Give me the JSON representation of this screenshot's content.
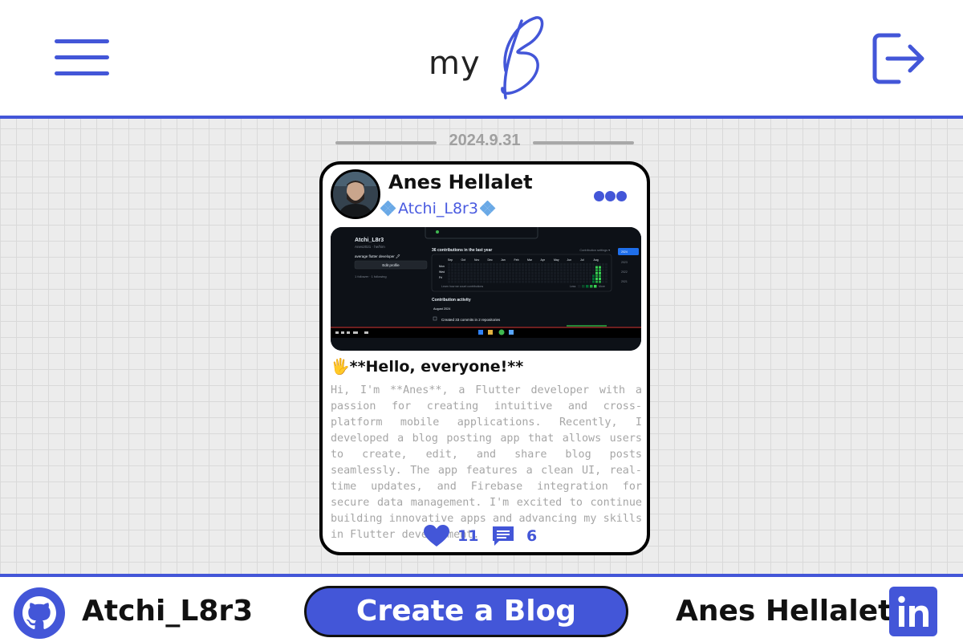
{
  "header": {
    "logo_text": "my",
    "logo_letter": "B",
    "accent_color": "#4356d8"
  },
  "feed": {
    "date": "2024.9.31",
    "post": {
      "author_name": "Anes Hellalet",
      "author_handle": "Atchi_L8r3",
      "title": "🖐**Hello, everyone!**",
      "body": "Hi, I'm **Anes**, a Flutter developer with a passion for creating intuitive and cross-platform mobile applications. Recently, I developed a blog posting app that allows users to create, edit, and share blog posts seamlessly. The app features a clean UI, real-time updates, and Firebase integration for secure data management. I'm excited to continue building innovative apps and advancing my skills in Flutter development.",
      "likes": "11",
      "comments": "6",
      "image": {
        "profile_name": "Atchi_L8r3",
        "profile_sub": "Anes2021 · he/him",
        "profile_bio": "average flutter developer 🖋",
        "edit_profile": "Edit profile",
        "followers": "1 follower · 1 following",
        "contrib_title": "36 contributions in the last year",
        "contrib_settings": "Contribution settings ▾",
        "months": [
          "Sep",
          "Oct",
          "Nov",
          "Dec",
          "Jan",
          "Feb",
          "Mar",
          "Apr",
          "May",
          "Jun",
          "Jul",
          "Aug"
        ],
        "days": [
          "Mon",
          "Wed",
          "Fri"
        ],
        "learn": "Learn how we count contributions",
        "less": "Less",
        "more": "More",
        "activity_title": "Contribution activity",
        "activity_month": "August 2024",
        "activity_item": "Created 33 commits in 2 repositories",
        "years": [
          "2024",
          "2023",
          "2022",
          "2021"
        ]
      }
    }
  },
  "footer": {
    "github_label": "Atchi_L8r3",
    "create_label": "Create a Blog",
    "linkedin_label": "Anes Hellalet"
  }
}
